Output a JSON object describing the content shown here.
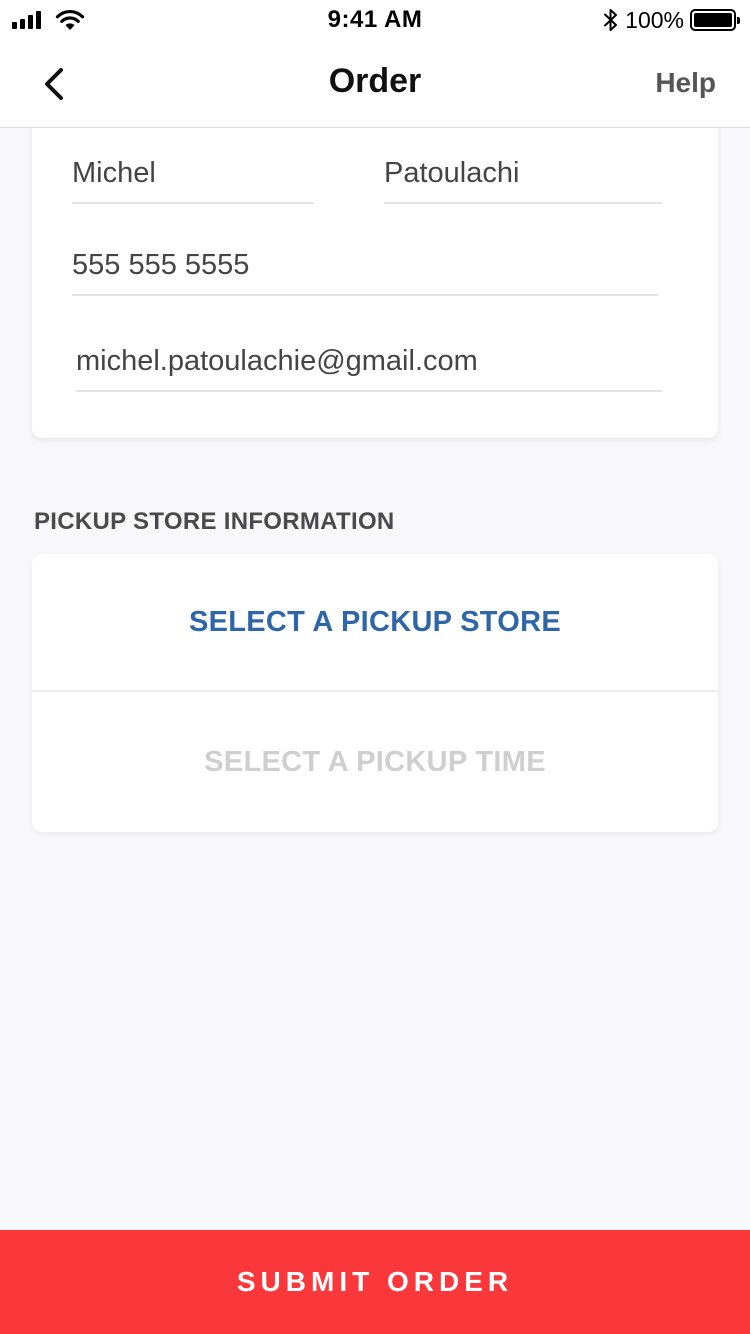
{
  "status_bar": {
    "time": "9:41 AM",
    "battery_percent": "100%",
    "battery_level": 1.0,
    "icons": [
      "signal-icon",
      "wifi-icon",
      "bluetooth-icon",
      "battery-icon"
    ]
  },
  "nav": {
    "title": "Order",
    "help_label": "Help",
    "back_icon": "chevron-left-icon"
  },
  "contact": {
    "first_name": "Michel",
    "last_name": "Patoulachi",
    "phone": "555 555 5555",
    "email": "michel.patoulachie@gmail.com"
  },
  "pickup": {
    "section_label": "PICKUP STORE INFORMATION",
    "store_label": "SELECT A PICKUP STORE",
    "time_label": "SELECT A PICKUP TIME"
  },
  "submit": {
    "label": "SUBMIT ORDER"
  },
  "colors": {
    "accent": "#2f66a8",
    "submit": "#fa383b",
    "disabled_text": "#cfcfcf",
    "background": "#f8f7fa"
  }
}
